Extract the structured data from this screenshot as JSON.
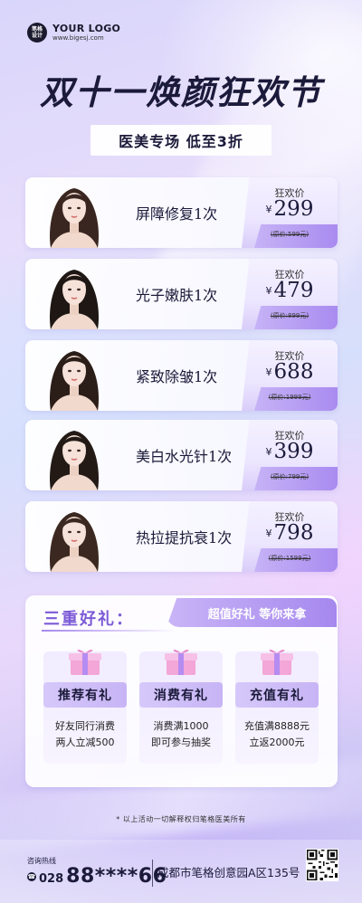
{
  "logo": {
    "mark_line1": "笔格",
    "mark_line2": "设计",
    "name": "YOUR LOGO",
    "url": "www.bigesj.com"
  },
  "title": "双十一焕颜狂欢节",
  "subtitle": "医美专场 低至3折",
  "products": [
    {
      "name": "屏障修复1次",
      "price_label": "狂欢价",
      "currency": "¥",
      "price": "299",
      "original": "(原价:599元)"
    },
    {
      "name": "光子嫩肤1次",
      "price_label": "狂欢价",
      "currency": "¥",
      "price": "479",
      "original": "(原价:899元)"
    },
    {
      "name": "紧致除皱1次",
      "price_label": "狂欢价",
      "currency": "¥",
      "price": "688",
      "original": "(原价:1999元)"
    },
    {
      "name": "美白水光针1次",
      "price_label": "狂欢价",
      "currency": "¥",
      "price": "399",
      "original": "(原价:799元)"
    },
    {
      "name": "热拉提抗衰1次",
      "price_label": "狂欢价",
      "currency": "¥",
      "price": "798",
      "original": "(原价:1599元)"
    }
  ],
  "gifts": {
    "title": "三重好礼：",
    "tag": "超值好礼 等你来拿",
    "items": [
      {
        "label": "推荐有礼",
        "line1": "好友同行消费",
        "line2": "两人立减500"
      },
      {
        "label": "消费有礼",
        "line1": "消费满1000",
        "line2": "即可参与抽奖"
      },
      {
        "label": "充值有礼",
        "line1": "充值满8888元",
        "line2": "立返2000元"
      }
    ]
  },
  "disclaimer": "* 以上活动一切解释权归笔格医美所有",
  "footer": {
    "hotline_label": "咨询热线",
    "phone_icon": "phone-icon",
    "area_code": "028",
    "number": "88****66",
    "address": "成都市笔格创意园A区135号"
  },
  "colors": {
    "accent": "#a688ee",
    "title": "#1b1a3a",
    "gift_title": "#7c5bd6"
  }
}
